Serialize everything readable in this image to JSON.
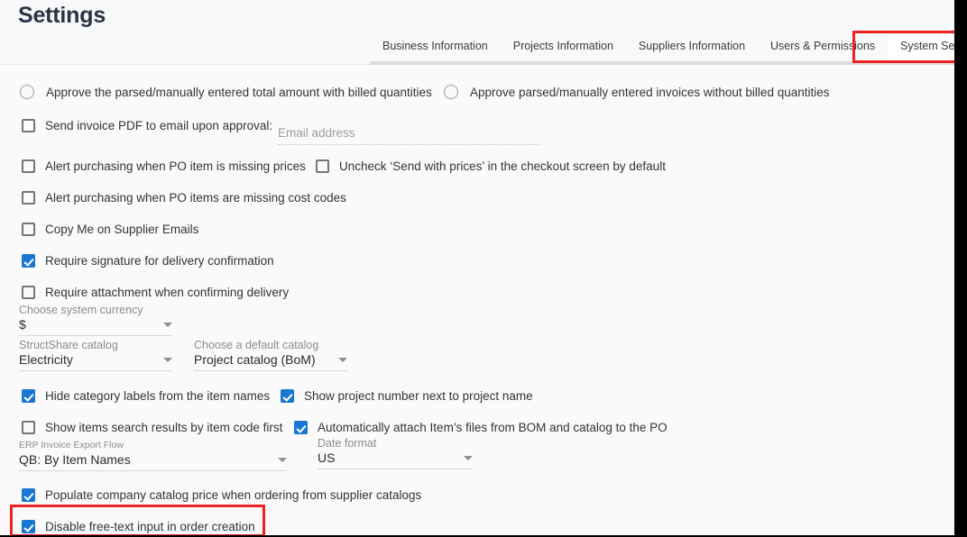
{
  "header": {
    "title": "Settings",
    "tabs": [
      {
        "label": "Business Information",
        "active": false
      },
      {
        "label": "Projects Information",
        "active": false
      },
      {
        "label": "Suppliers Information",
        "active": false
      },
      {
        "label": "Users & Permissions",
        "active": false
      },
      {
        "label": "System Settings",
        "active": true
      }
    ]
  },
  "settings": {
    "approval_radios": [
      {
        "label": "Approve the parsed/manually entered total amount with billed quantities",
        "selected": false
      },
      {
        "label": "Approve parsed/manually entered invoices without billed quantities",
        "selected": false
      }
    ],
    "send_pdf": {
      "label": "Send invoice PDF to email upon approval:",
      "checked": false,
      "email_placeholder": "Email address",
      "email_value": ""
    },
    "checkboxes": {
      "alert_missing_prices": {
        "label": "Alert purchasing when PO item is missing prices",
        "checked": false
      },
      "uncheck_send_prices": {
        "label": "Uncheck ‘Send with prices’ in the checkout screen by default",
        "checked": false
      },
      "alert_missing_cost_codes": {
        "label": "Alert purchasing when PO items are missing cost codes",
        "checked": false
      },
      "copy_me_supplier_emails": {
        "label": "Copy Me on Supplier Emails",
        "checked": false
      },
      "require_signature": {
        "label": "Require signature for delivery confirmation",
        "checked": true
      },
      "require_attachment": {
        "label": "Require attachment when confirming delivery",
        "checked": false
      },
      "hide_category_labels": {
        "label": "Hide category labels from the item names",
        "checked": true
      },
      "show_project_number": {
        "label": "Show project number next to project name",
        "checked": true
      },
      "search_by_item_code": {
        "label": "Show items search results by item code first",
        "checked": false
      },
      "auto_attach_files": {
        "label": "Automatically attach Item’s files from BOM and catalog to the PO",
        "checked": true
      },
      "populate_catalog_price": {
        "label": "Populate company catalog price when ordering from supplier catalogs",
        "checked": true
      },
      "disable_free_text": {
        "label": "Disable free-text input in order creation",
        "checked": true
      }
    },
    "selects": {
      "system_currency": {
        "label": "Choose system currency",
        "value": "$"
      },
      "structshare_catalog": {
        "label": "StructShare catalog",
        "value": "Electricity"
      },
      "default_catalog": {
        "label": "Choose a default catalog",
        "value": "Project catalog (BoM)"
      },
      "erp_invoice_export_flow": {
        "label": "ERP Invoice Export Flow",
        "value": "QB: By Item Names"
      },
      "date_format": {
        "label": "Date format",
        "value": "US"
      }
    }
  },
  "annotations": {
    "highlight_color": "#ee2222",
    "accent_color": "#1976d2",
    "boxes": [
      {
        "name": "system-settings-tab-highlight"
      },
      {
        "name": "disable-free-text-highlight"
      }
    ]
  }
}
